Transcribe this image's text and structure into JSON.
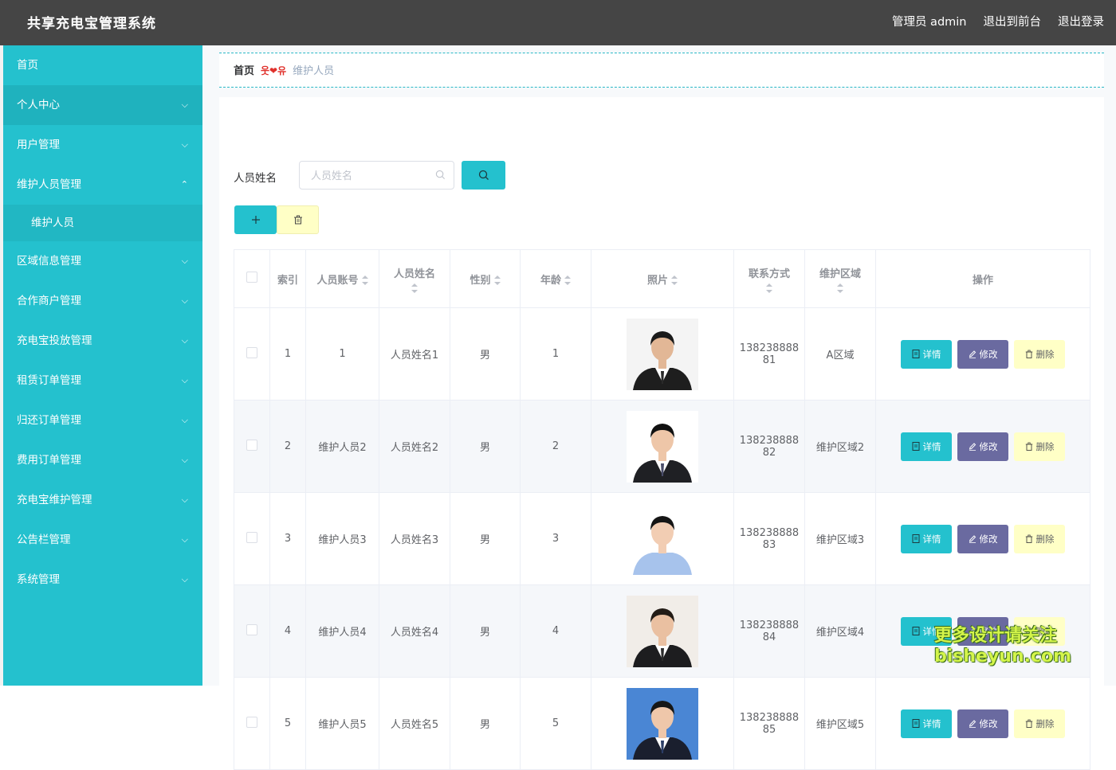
{
  "app": {
    "title": "共享充电宝管理系统"
  },
  "header": {
    "user_label": "管理员 admin",
    "front_label": "退出到前台",
    "logout_label": "退出登录"
  },
  "sidebar": {
    "items": [
      {
        "label": "首页",
        "has_chevron": false
      },
      {
        "label": "个人中心",
        "has_chevron": true
      },
      {
        "label": "用户管理",
        "has_chevron": true
      },
      {
        "label": "维护人员管理",
        "has_chevron": true,
        "expanded": true
      },
      {
        "label": "区域信息管理",
        "has_chevron": true
      },
      {
        "label": "合作商户管理",
        "has_chevron": true
      },
      {
        "label": "充电宝投放管理",
        "has_chevron": true
      },
      {
        "label": "租赁订单管理",
        "has_chevron": true
      },
      {
        "label": "归还订单管理",
        "has_chevron": true
      },
      {
        "label": "费用订单管理",
        "has_chevron": true
      },
      {
        "label": "充电宝维护管理",
        "has_chevron": true
      },
      {
        "label": "公告栏管理",
        "has_chevron": true
      },
      {
        "label": "系统管理",
        "has_chevron": true
      }
    ],
    "submenu_label": "维护人员"
  },
  "breadcrumb": {
    "home": "首页",
    "separator": "웃❤유",
    "current": "维护人员"
  },
  "search": {
    "label": "人员姓名",
    "placeholder": "人员姓名",
    "value": ""
  },
  "table": {
    "headers": {
      "index": "索引",
      "account": "人员账号",
      "name": "人员姓名",
      "gender": "性别",
      "age": "年龄",
      "photo": "照片",
      "phone": "联系方式",
      "area": "维护区域",
      "ops": "操作"
    },
    "rows": [
      {
        "index": "1",
        "account": "1",
        "name": "人员姓名1",
        "gender": "男",
        "age": "1",
        "phone_a": "138238888",
        "phone_b": "81",
        "area": "A区域",
        "photo": "man-dark-suit-red-backdrop"
      },
      {
        "index": "2",
        "account": "维护人员2",
        "name": "人员姓名2",
        "gender": "男",
        "age": "2",
        "phone_a": "138238888",
        "phone_b": "82",
        "area": "维护区域2",
        "photo": "man-suit-white-backdrop"
      },
      {
        "index": "3",
        "account": "维护人员3",
        "name": "人员姓名3",
        "gender": "男",
        "age": "3",
        "phone_a": "138238888",
        "phone_b": "83",
        "area": "维护区域3",
        "photo": "woman-blue-shirt"
      },
      {
        "index": "4",
        "account": "维护人员4",
        "name": "人员姓名4",
        "gender": "男",
        "age": "4",
        "phone_a": "138238888",
        "phone_b": "84",
        "area": "维护区域4",
        "photo": "man-suit-light-backdrop"
      },
      {
        "index": "5",
        "account": "维护人员5",
        "name": "人员姓名5",
        "gender": "男",
        "age": "5",
        "phone_a": "138238888",
        "phone_b": "85",
        "area": "维护区域5",
        "photo": "man-suit-blue-backdrop"
      }
    ],
    "ops": {
      "detail": "详情",
      "edit": "修改",
      "delete": "删除"
    }
  },
  "watermark": {
    "line1": "更多设计请关注",
    "line2": "bisheyun.com"
  },
  "colors": {
    "header_bg": "#454545",
    "sidebar_bg": "#24c1ce",
    "accent": "#24c1ce",
    "edit_btn": "#6a6aa0",
    "delete_btn": "#ffffc6"
  }
}
